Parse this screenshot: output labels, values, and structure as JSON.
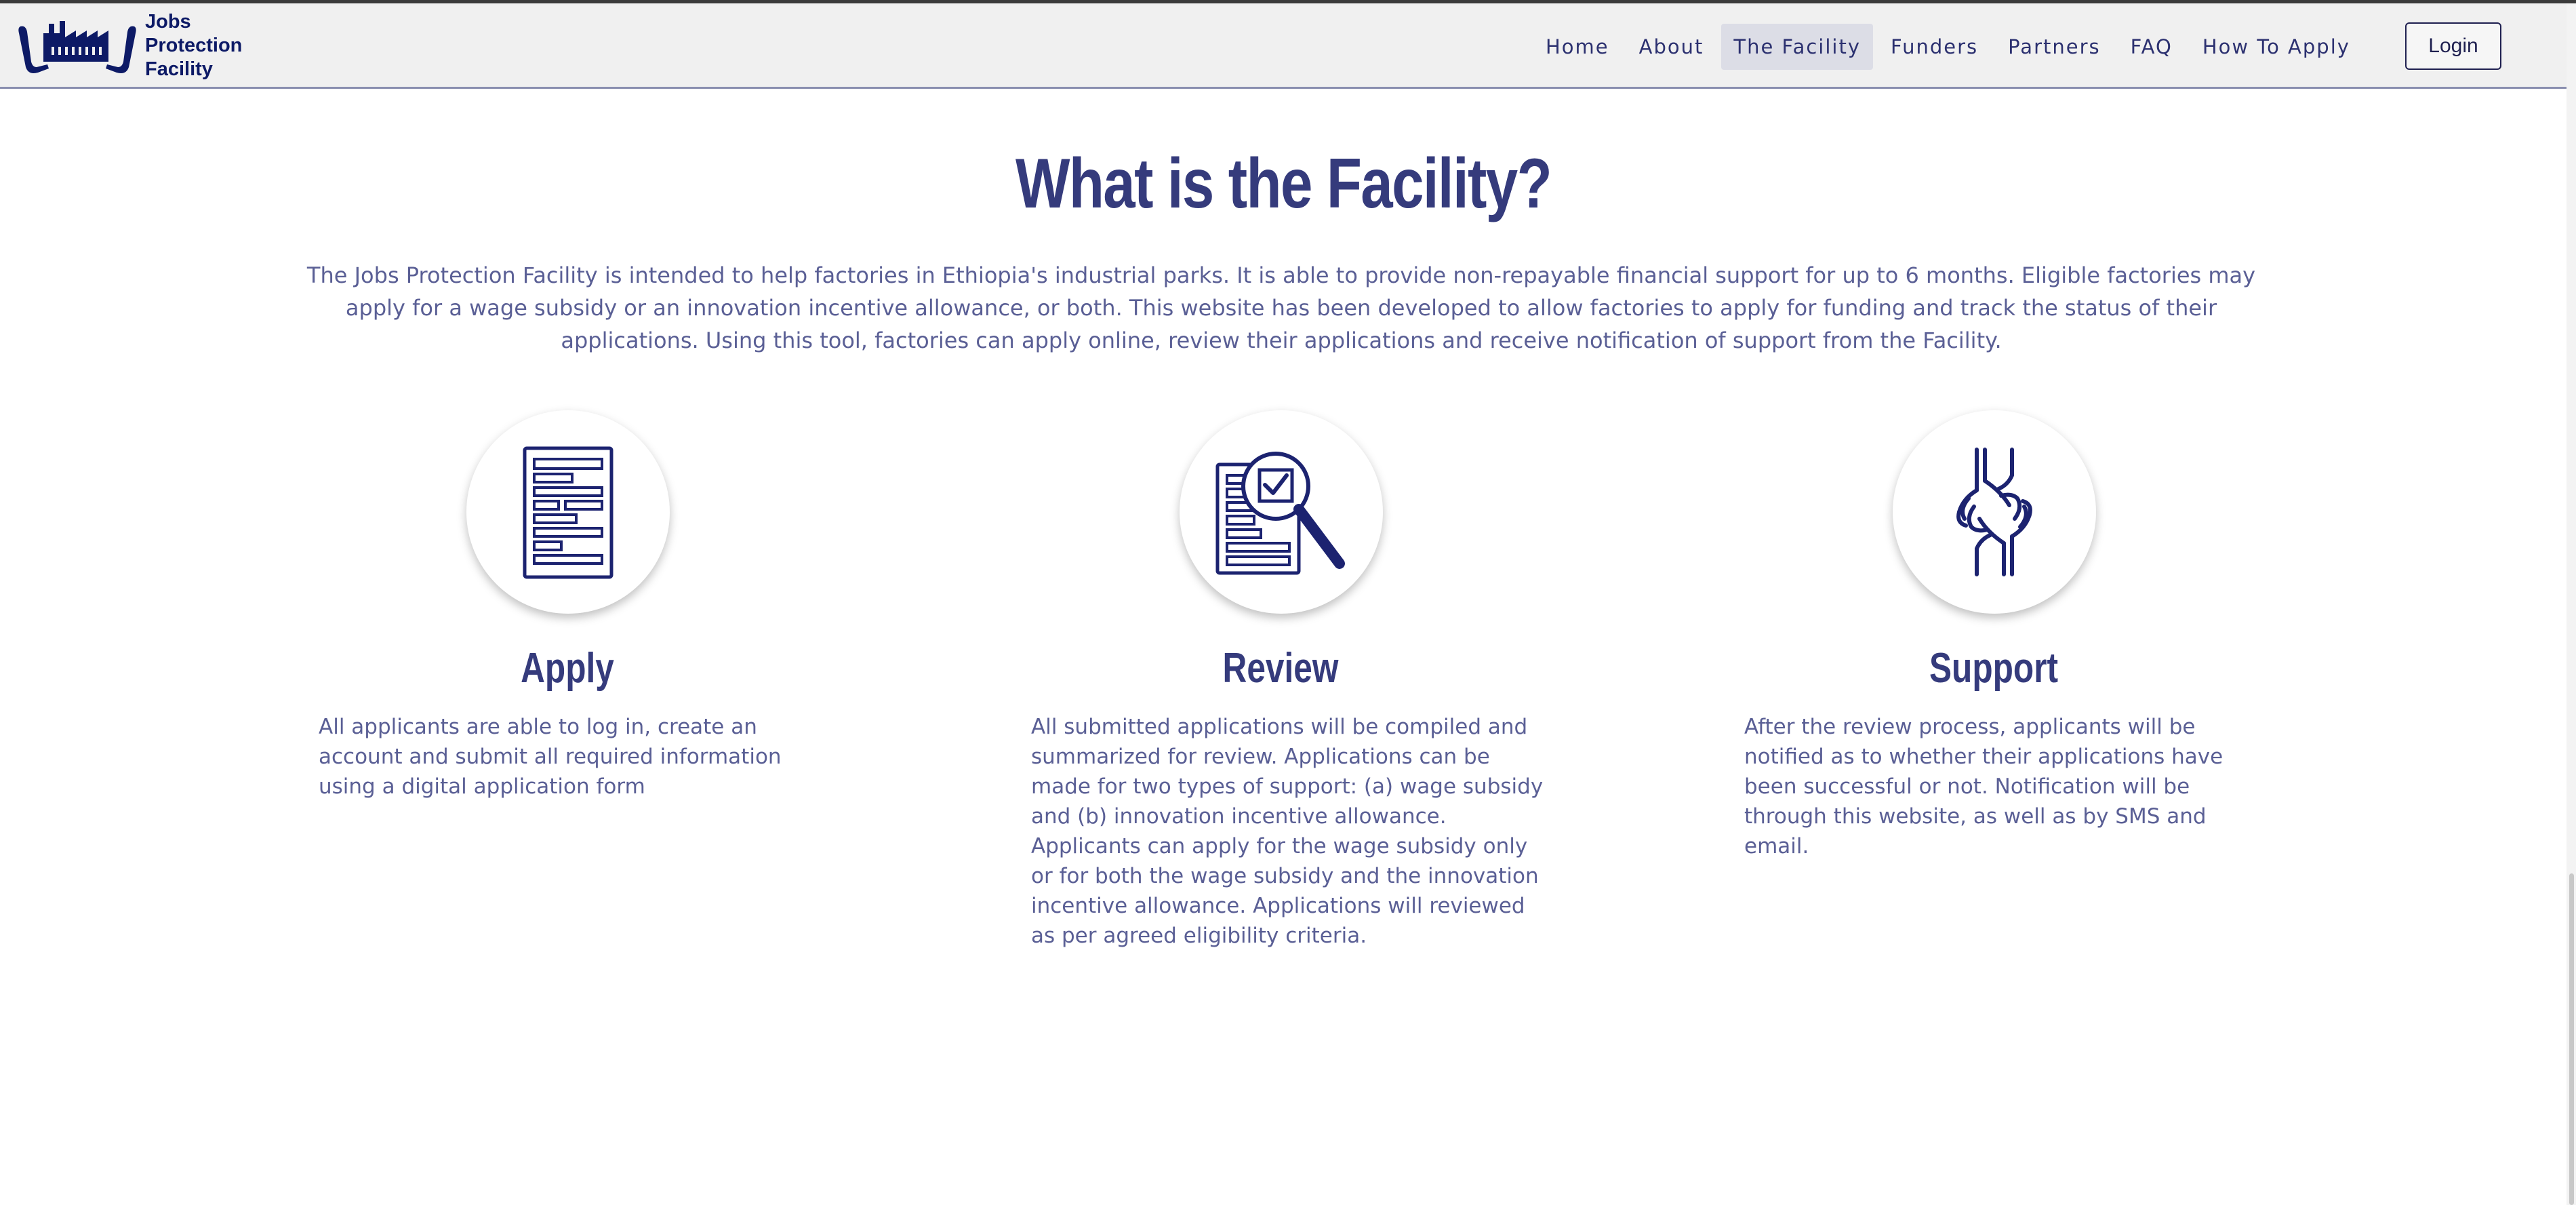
{
  "logo": {
    "line1": "Jobs",
    "line2": "Protection",
    "line3": "Facility",
    "icon": "factory-hands-icon"
  },
  "nav": {
    "items": [
      {
        "label": "Home"
      },
      {
        "label": "About"
      },
      {
        "label": "The Facility",
        "active": true
      },
      {
        "label": "Funders"
      },
      {
        "label": "Partners"
      },
      {
        "label": "FAQ"
      },
      {
        "label": "How To Apply"
      }
    ],
    "login_label": "Login"
  },
  "section": {
    "title": "What is the Facility?",
    "intro": "The Jobs Protection Facility is intended to help factories in Ethiopia's industrial parks. It is able to provide non-repayable financial support for up to 6 months. Eligible factories may apply for a wage subsidy or an innovation incentive allowance, or both. This website has been developed to allow factories to apply for funding and track the status of their applications. Using this tool, factories can apply online, review their applications and receive notification of support from the Facility."
  },
  "cards": [
    {
      "icon": "document-form-icon",
      "title": "Apply",
      "text": "All applicants are able to log in, create an account and submit all required information using a digital application form"
    },
    {
      "icon": "document-magnifier-check-icon",
      "title": "Review",
      "text": "All submitted applications will be compiled and summarized for review. Applications can be made for two types of support: (a) wage subsidy and (b) innovation incentive allowance. Applicants can apply for the wage subsidy only or for both the wage subsidy and the innovation incentive allowance. Applications will reviewed as per agreed eligibility criteria."
    },
    {
      "icon": "handshake-icon",
      "title": "Support",
      "text": "After the review process, applicants will be notified as to whether their applications have been successful or not. Notification will be through this website, as well as by SMS and email."
    }
  ],
  "colors": {
    "brand": "#0d1a66",
    "heading": "#353b7c",
    "body_text": "#5a5f95",
    "nav_bg": "#f0f0f0",
    "nav_active_bg": "#dcdde6"
  }
}
